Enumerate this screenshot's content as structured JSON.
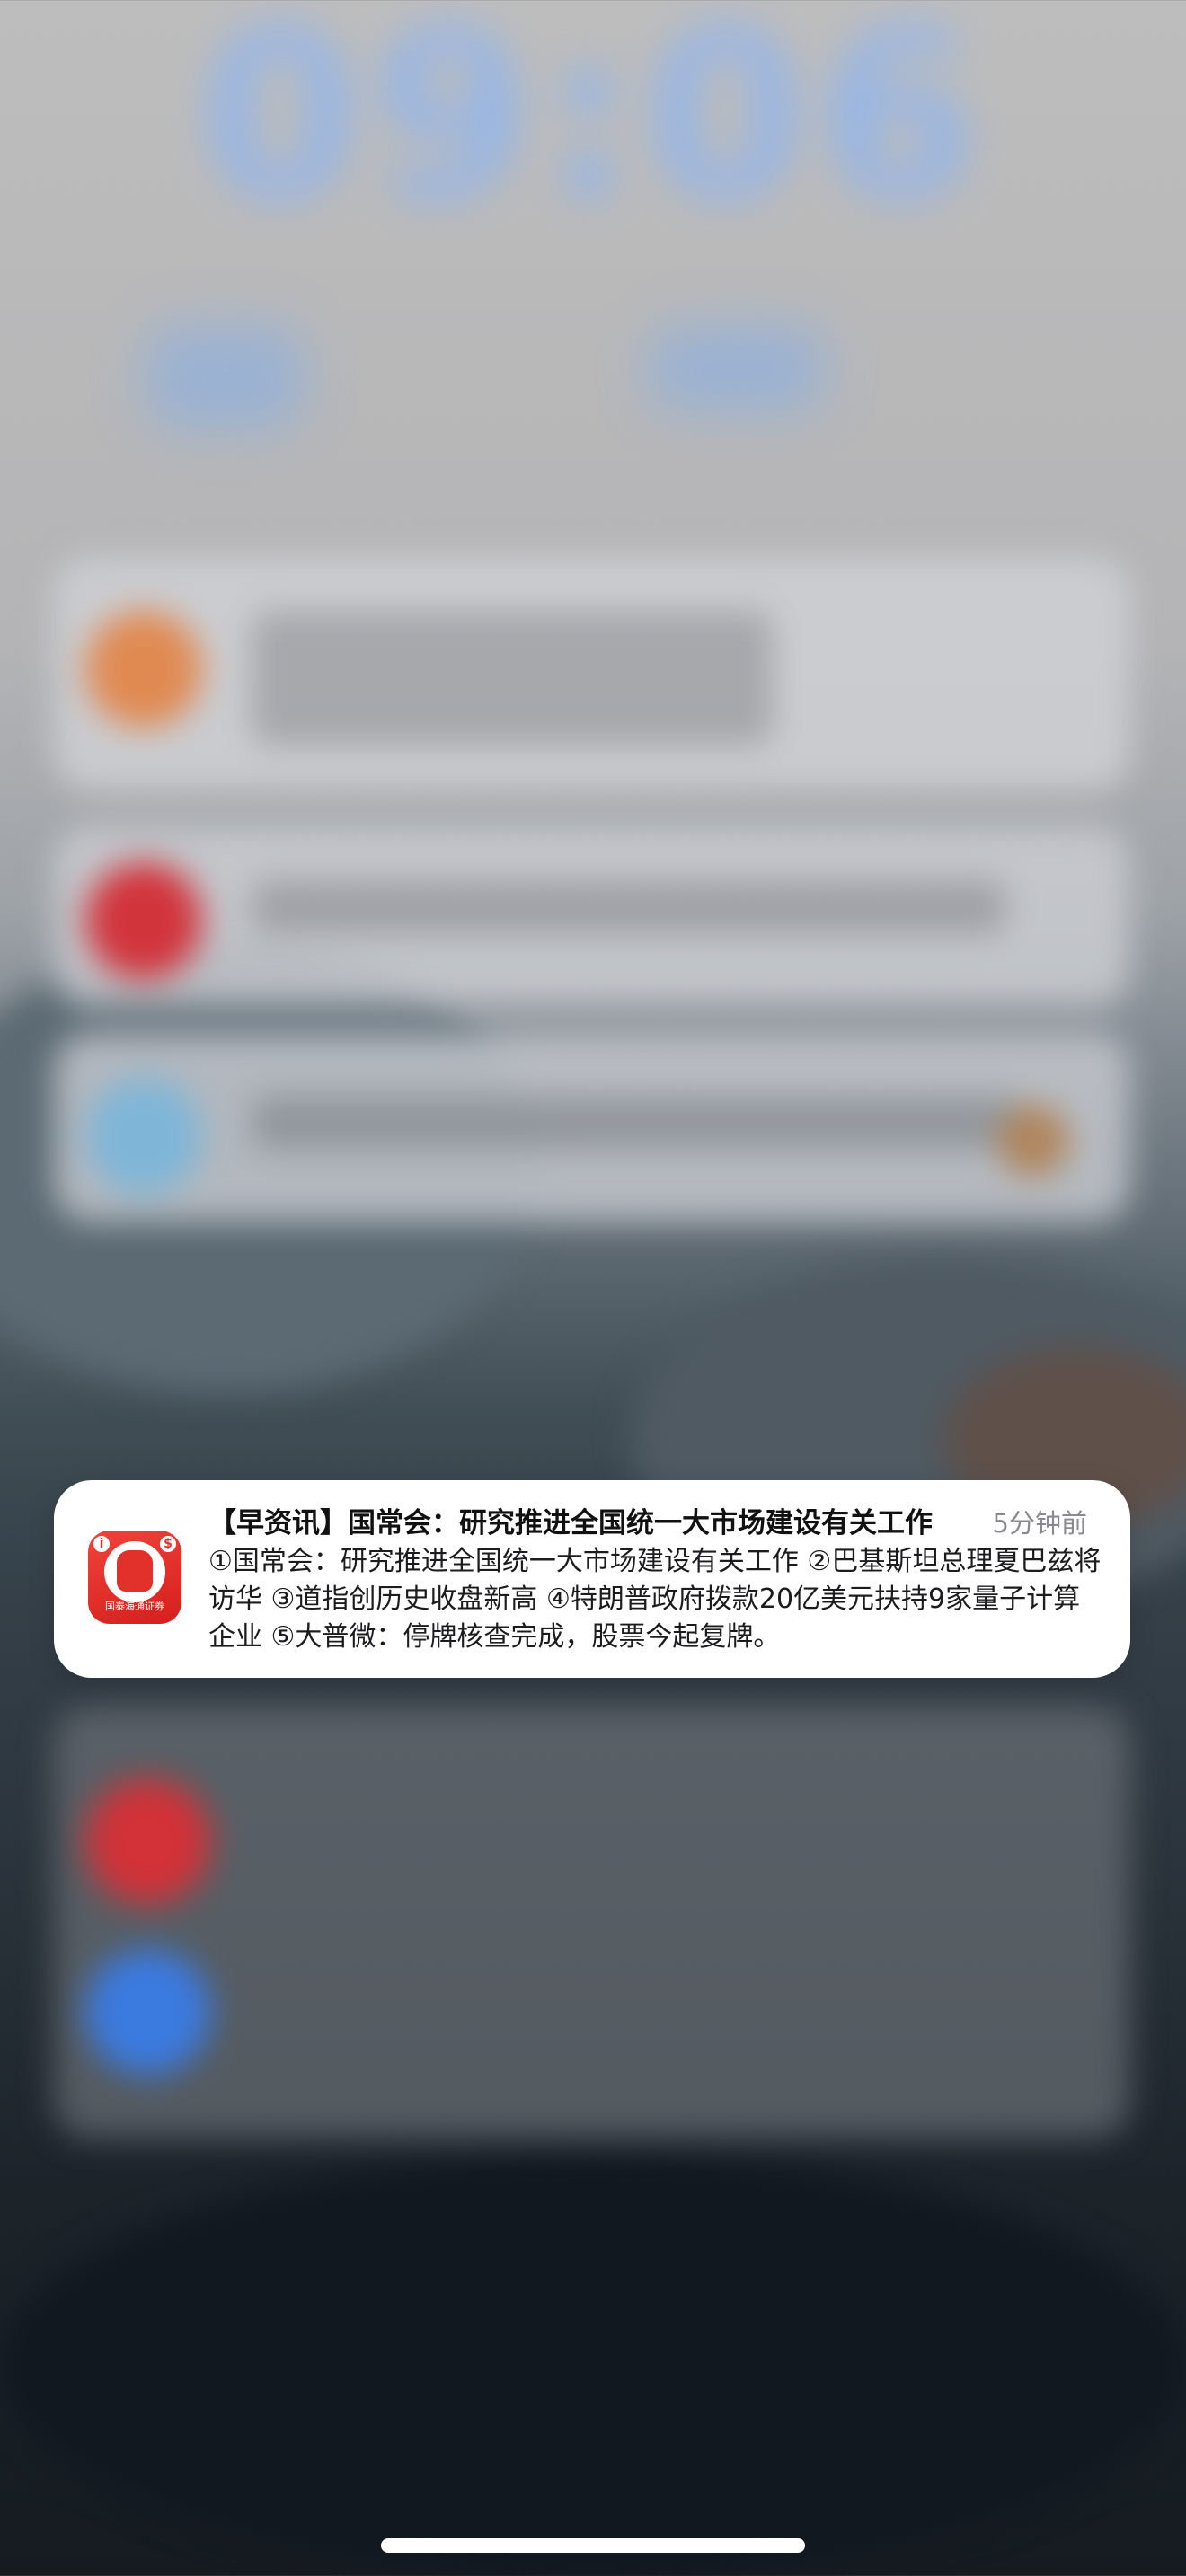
{
  "lock_screen": {
    "clock_text": "09:06"
  },
  "notification": {
    "app_icon_name": "guotai-haitong-securities-icon",
    "app_icon_caption": "国泰海通证券",
    "title": "【早资讯】国常会：研究推进全国统一大市场建设有关工作",
    "time": "5分钟前",
    "body": "①国常会：研究推进全国统一大市场建设有关工作 ②巴基斯坦总理夏巴兹将访华 ③道指创历史收盘新高 ④特朗普政府拨款20亿美元扶持9家量子计算企业 ⑤大普微：停牌核查完成，股票今起复牌。"
  },
  "colors": {
    "clock": "#96b6e8",
    "notification_bg": "#ffffff",
    "app_icon_red": "#e2302b"
  }
}
